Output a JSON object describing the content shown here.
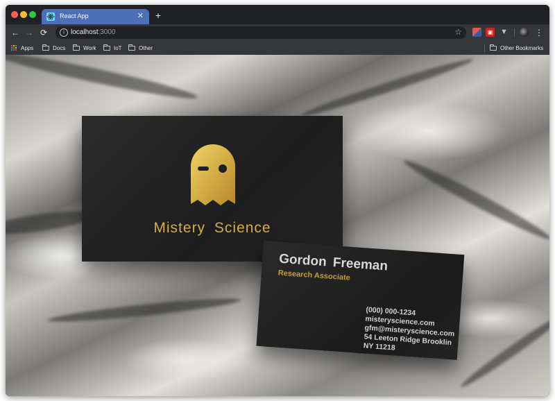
{
  "browser": {
    "tab": {
      "title": "React App"
    },
    "address": {
      "host": "localhost",
      "port": ":3000"
    }
  },
  "bookmarks": [
    {
      "label": "Apps",
      "icon": "apps-grid-icon"
    },
    {
      "label": "Docs",
      "icon": "folder-icon"
    },
    {
      "label": "Work",
      "icon": "folder-icon"
    },
    {
      "label": "IoT",
      "icon": "folder-icon"
    },
    {
      "label": "Other",
      "icon": "folder-icon"
    }
  ],
  "other_bookmarks": {
    "label": "Other Bookmarks",
    "icon": "folder-icon"
  },
  "cards": {
    "front": {
      "brand": "Mistery  Science",
      "logo": "ghost-logo"
    },
    "back": {
      "name": "Gordon  Freeman",
      "title": "Research Associate",
      "contact": [
        "(000) 000-1234",
        "misteryscience.com",
        "gfm@misteryscience.com",
        "54 Leeton Ridge Brooklin",
        "NY 11218"
      ]
    }
  },
  "colors": {
    "gold": "#d4ad45",
    "tab_active": "#4d6fb7",
    "card_dark": "#222222"
  }
}
